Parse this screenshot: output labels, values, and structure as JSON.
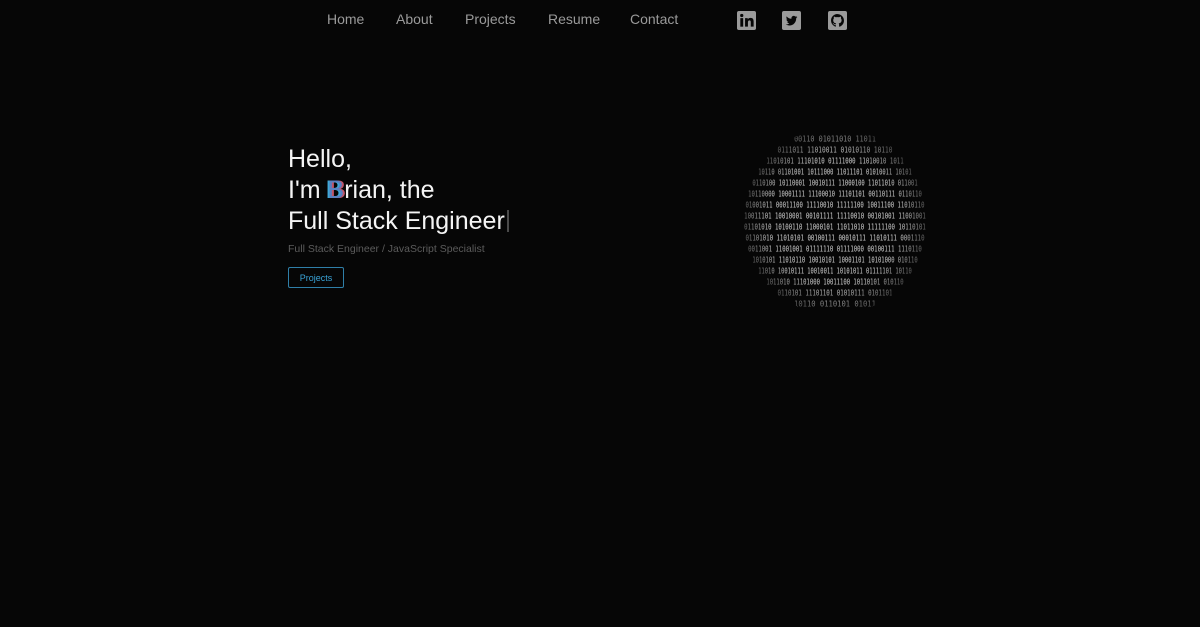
{
  "nav": {
    "links": [
      "Home",
      "About",
      "Projects",
      "Resume",
      "Contact"
    ],
    "social": [
      {
        "icon": "linkedin-icon"
      },
      {
        "icon": "twitter-icon"
      },
      {
        "icon": "github-icon"
      }
    ]
  },
  "hero": {
    "line1": "Hello,",
    "line2_prefix": "I'm ",
    "line2_glitch": "B",
    "line2_suffix": "rian, the",
    "line3": "Full Stack Engineer",
    "subtitle": "Full Stack Engineer / JavaScript Specialist",
    "button_label": "Projects"
  },
  "globe": {
    "binary_rows": [
      "00110 01011010 11011",
      "0111011 11010011 01010110 10110",
      "11010101 11101010 01111000 11010010 1011",
      "10110 01101001 10111000 11011101 01010011 10101",
      "0110100 10110001 10010111 11000100 11011010 011001",
      "10110000 10001111 11100010 11101101 00110111 0110110",
      "01001011 00011100 11110010 11111100 10011100 11010110",
      "10011101 10010001 00101111 11110010 00101001 11001001",
      "01101010 10100110 11000101 11011010 11111100 10110101",
      "01101010 11010101 00100111 00010111 11010111 0001110",
      "0011001 11001001 01111110 01111000 00100111 1110110",
      "1010101 11010110 10010101 10001101 10101000 010110",
      "11010 10010111 10010011 10101011 01111101 10110",
      "1011010 11101000 10011100 10110101 010110",
      "0110101 11101101 01010111 0101101",
      "10110 0110101 01011"
    ]
  }
}
